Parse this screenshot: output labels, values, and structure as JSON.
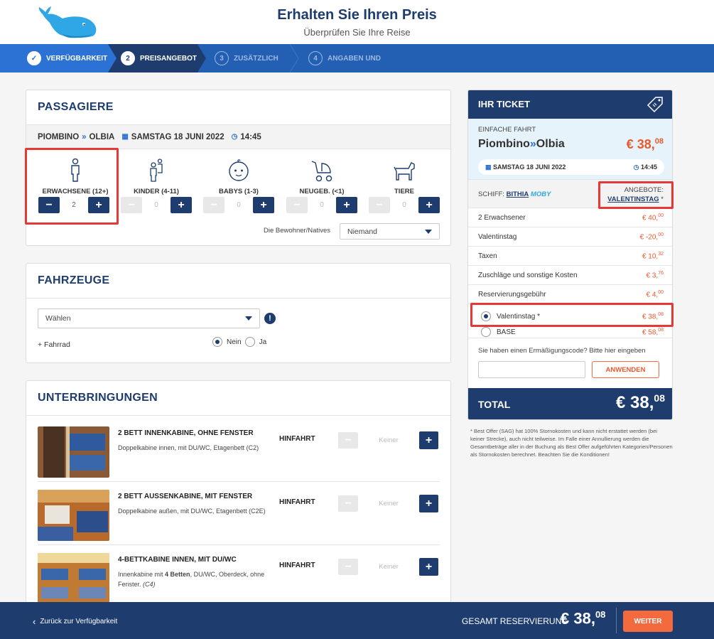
{
  "header": {
    "title": "Erhalten Sie Ihren Preis",
    "subtitle": "Überprüfen Sie Ihre Reise"
  },
  "steps": [
    {
      "num": "✓",
      "label": "VERFÜGBARKEIT",
      "state": "done"
    },
    {
      "num": "2",
      "label": "PREISANGEBOT",
      "state": "active"
    },
    {
      "num": "3",
      "label": "ZUSÄTZLICH",
      "state": "future"
    },
    {
      "num": "4",
      "label": "ANGABEN UND",
      "state": "future"
    }
  ],
  "passengers": {
    "title": "PASSAGIERE",
    "route_from": "PIOMBINO",
    "route_to": "OLBIA",
    "date": "SAMSTAG 18 JUNI 2022",
    "time": "14:45",
    "types": [
      {
        "label": "ERWACHSENE (12+)",
        "icon": "adult-icon",
        "value": "2"
      },
      {
        "label": "KINDER (4-11)",
        "icon": "child-icon",
        "value": "0"
      },
      {
        "label": "BABYS (1-3)",
        "icon": "baby-icon",
        "value": "0"
      },
      {
        "label": "NEUGEB. (<1)",
        "icon": "stroller-icon",
        "value": "0"
      },
      {
        "label": "TIERE",
        "icon": "dog-icon",
        "value": "0"
      }
    ],
    "residents_label": "Die Bewohner/Natives",
    "residents_value": "Niemand"
  },
  "vehicles": {
    "title": "FAHRZEUGE",
    "select_value": "Wählen",
    "bike_label": "+ Fahrrad",
    "no_label": "Nein",
    "yes_label": "Ja"
  },
  "accommodations": {
    "title": "UNTERBRINGUNGEN",
    "direction": "HINFAHRT",
    "none_label": "Keiner",
    "items": [
      {
        "name": "2 BETT INNENKABINE, OHNE FENSTER",
        "desc": "Doppelkabine innen, mit DU/WC, Etagenbett (C2)"
      },
      {
        "name": "2 BETT AUSSENKABINE, MIT FENSTER",
        "desc": "Doppelkabine außen, mit DU/WC, Etagenbett (C2E)"
      },
      {
        "name": "4-BETTKABINE INNEN, MIT DU/WC",
        "desc_pre": "Innenkabine mit ",
        "desc_bold": "4 Betten",
        "desc_post": ", DU/WC, Oberdeck, ohne Fenster. ",
        "desc_code": "(C4)"
      }
    ]
  },
  "ticket": {
    "title": "IHR TICKET",
    "trip_type": "EINFACHE FAHRT",
    "from": "Piombino",
    "to": "Olbia",
    "price_main": "€ 38,",
    "price_cents": "08",
    "date": "SAMSTAG 18 JUNI 2022",
    "time": "14:45",
    "ship_label": "SCHIFF:",
    "ship_name": "BITHIA",
    "ship_brand": "MOBY",
    "offers_label": "ANGEBOTE:",
    "offers_value": "VALENTINSTAG",
    "offers_star": "*",
    "rows": [
      {
        "label": "2 Erwachsener",
        "main": "€ 40,",
        "cents": "00"
      },
      {
        "label": "Valentinstag",
        "main": "€ -20,",
        "cents": "00"
      },
      {
        "label": "Taxen",
        "main": "€ 10,",
        "cents": "32"
      },
      {
        "label": "Zuschläge und sonstige Kosten",
        "main": "€ 3,",
        "cents": "76"
      },
      {
        "label": "Reservierungsgebühr",
        "main": "€ 4,",
        "cents": "00"
      }
    ],
    "options": [
      {
        "label": "Valentinstag *",
        "main": "€ 38,",
        "cents": "08",
        "selected": true
      },
      {
        "label": "BASE",
        "main": "€ 58,",
        "cents": "08",
        "selected": false
      }
    ],
    "discount_prompt": "Sie haben einen Ermäßigungscode? Bitte hier eingeben",
    "apply_label": "ANWENDEN",
    "total_label": "TOTAL",
    "total_main": "€ 38,",
    "total_cents": "08",
    "footnote": "* Best Offer (SAG) hat 100% Stornokosten und kann nicht erstattet werden (bei keiner Strecke), auch nicht teilweise. Im Falle einer Annullierung werden die Gesamtbeträge aller in der Buchung als Best Offer aufgeführten Kategorien/Personen als Stornokosten berechnet. Beachten Sie die Konditionen!"
  },
  "footer": {
    "back_label": "Zurück zur Verfügbarkeit",
    "total_label": "GESAMT RESERVIERUNG",
    "total_main": "€ 38,",
    "total_cents": "08",
    "next_label": "WEITER"
  },
  "colors": {
    "navy": "#1e3d6e",
    "blue": "#2360b4",
    "orange": "#f26a3e",
    "price_red": "#e85a2c",
    "highlight": "#e53935"
  }
}
